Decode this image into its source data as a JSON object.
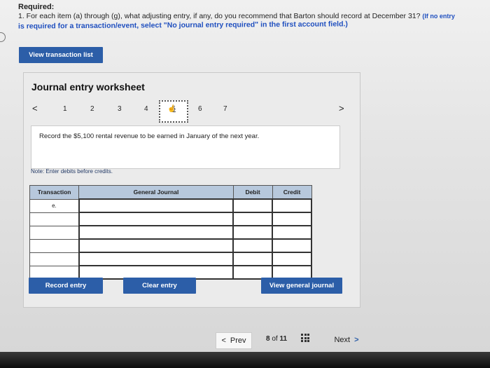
{
  "header": {
    "required": "Required:",
    "question": "1. For each item (a) through (g), what adjusting entry, if any, do you recommend that Barton should record at December 31?",
    "question_note": "(If no entry",
    "instruction": "is required for a transaction/event, select \"No journal entry required\" in the first account field.)"
  },
  "buttons": {
    "view_transaction_list": "View transaction list",
    "record_entry": "Record entry",
    "clear_entry": "Clear entry",
    "view_general_journal": "View general journal"
  },
  "worksheet": {
    "title": "Journal entry worksheet",
    "pages": [
      "1",
      "2",
      "3",
      "4",
      "5",
      "6",
      "7"
    ],
    "active_page": "5",
    "prev_arrow": "<",
    "next_arrow": ">",
    "description": "Record the $5,100 rental revenue to be earned in January of the next year.",
    "note": "Note: Enter debits before credits."
  },
  "table": {
    "headers": [
      "Transaction",
      "General Journal",
      "Debit",
      "Credit"
    ],
    "rows": [
      {
        "transaction": "e."
      },
      {
        "transaction": ""
      },
      {
        "transaction": ""
      },
      {
        "transaction": ""
      },
      {
        "transaction": ""
      },
      {
        "transaction": ""
      }
    ]
  },
  "footer": {
    "prev": "Prev",
    "page_current": "8",
    "page_of": "of",
    "page_total": "11",
    "next": "Next"
  },
  "icons": {
    "grid": "grid-icon",
    "cursor": "hand-pointer-icon"
  },
  "colors": {
    "accent": "#2c5ea8",
    "table_header": "#b7c8dc"
  }
}
